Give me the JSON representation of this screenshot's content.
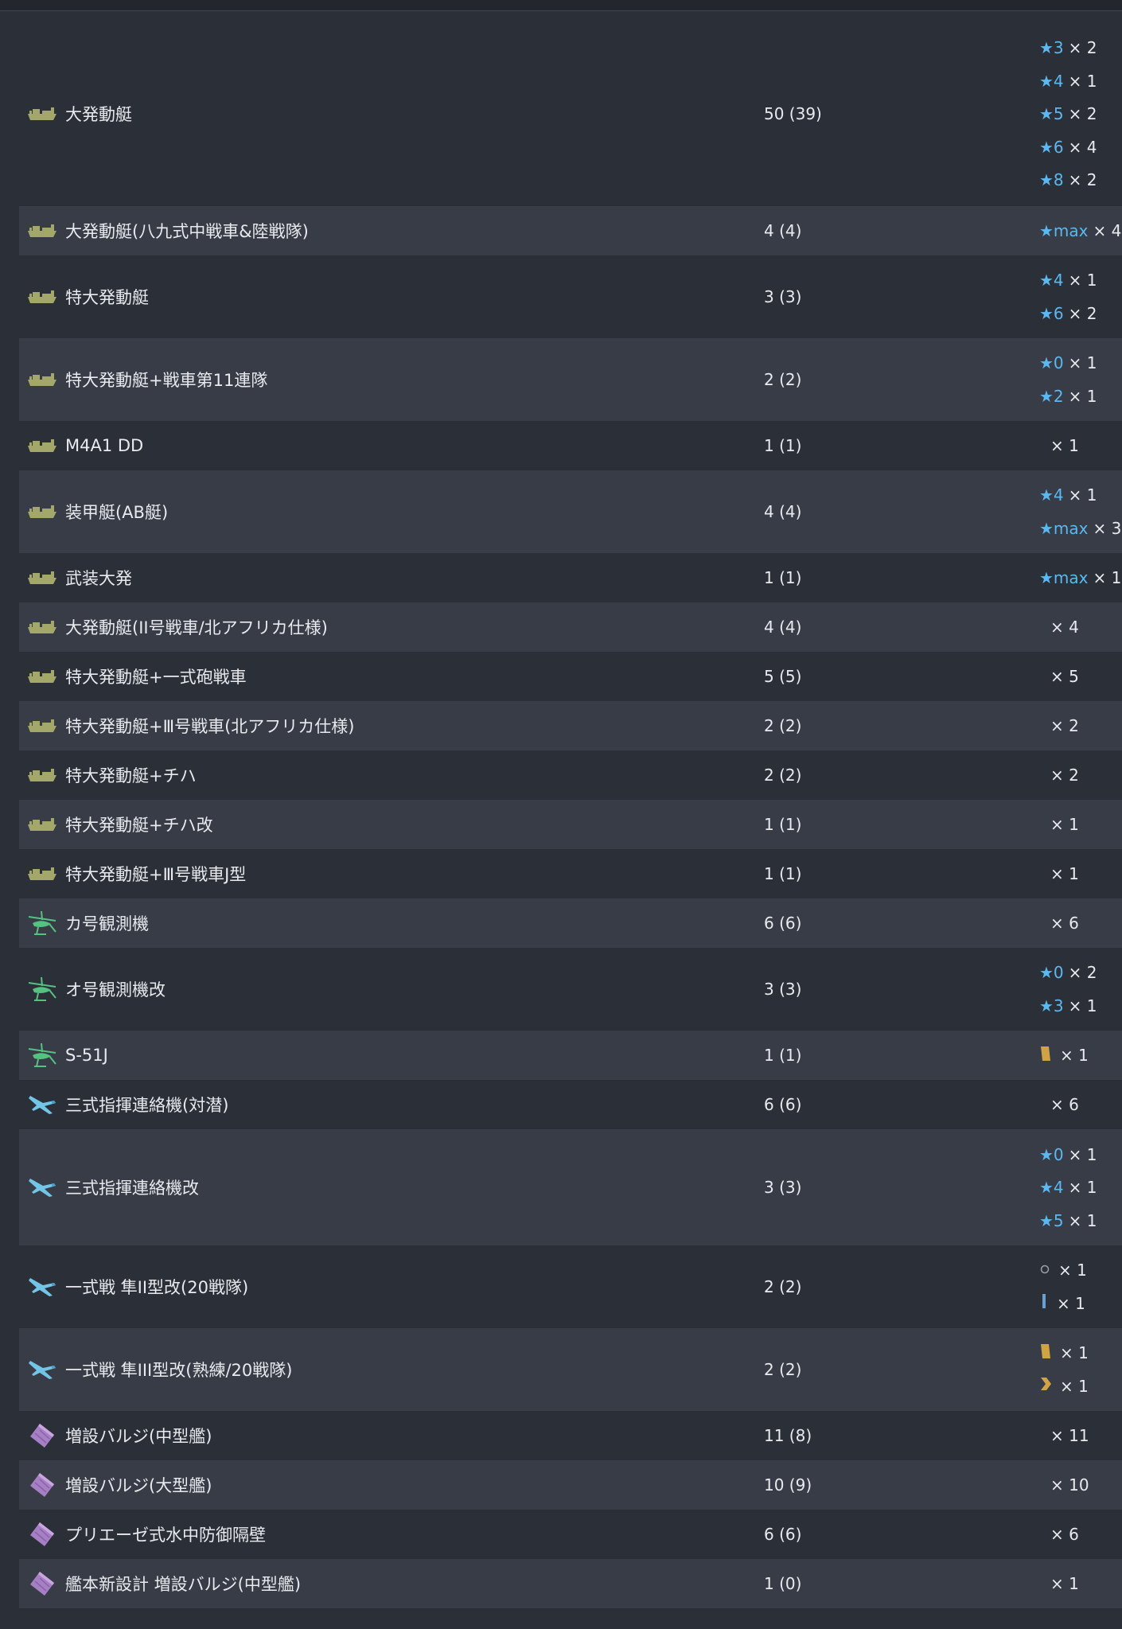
{
  "colors": {
    "star": "#5bb8f0",
    "landing_craft": "#a3a86a",
    "autogyro": "#56c282",
    "liaison": "#72c5e6",
    "bulge": "#a77fc5"
  },
  "rows": [
    {
      "name": "大発動艇",
      "count": "50 (39)",
      "icon": "landing-craft-icon",
      "levels": [
        {
          "star": "★3",
          "mul": "× 2"
        },
        {
          "star": "★4",
          "mul": "× 1"
        },
        {
          "star": "★5",
          "mul": "× 2"
        },
        {
          "star": "★6",
          "mul": "× 4"
        },
        {
          "star": "★8",
          "mul": "× 2"
        }
      ]
    },
    {
      "name": "大発動艇(八九式中戦車&陸戦隊)",
      "count": "4 (4)",
      "icon": "landing-craft-icon",
      "levels": [
        {
          "star": "★max",
          "mul": "× 4"
        }
      ]
    },
    {
      "name": "特大発動艇",
      "count": "3 (3)",
      "icon": "landing-craft-icon",
      "levels": [
        {
          "star": "★4",
          "mul": "× 1"
        },
        {
          "star": "★6",
          "mul": "× 2"
        }
      ]
    },
    {
      "name": "特大発動艇+戦車第11連隊",
      "count": "2 (2)",
      "icon": "landing-craft-icon",
      "levels": [
        {
          "star": "★0",
          "mul": "× 1"
        },
        {
          "star": "★2",
          "mul": "× 1"
        }
      ]
    },
    {
      "name": "M4A1 DD",
      "count": "1 (1)",
      "icon": "landing-craft-icon",
      "levels": [
        {
          "star": "",
          "mul": "× 1"
        }
      ]
    },
    {
      "name": "装甲艇(AB艇)",
      "count": "4 (4)",
      "icon": "landing-craft-icon",
      "levels": [
        {
          "star": "★4",
          "mul": "× 1"
        },
        {
          "star": "★max",
          "mul": "× 3"
        }
      ]
    },
    {
      "name": "武装大発",
      "count": "1 (1)",
      "icon": "landing-craft-icon",
      "levels": [
        {
          "star": "★max",
          "mul": "× 1"
        }
      ]
    },
    {
      "name": "大発動艇(II号戦車/北アフリカ仕様)",
      "count": "4 (4)",
      "icon": "landing-craft-icon",
      "levels": [
        {
          "star": "",
          "mul": "× 4"
        }
      ]
    },
    {
      "name": "特大発動艇+一式砲戦車",
      "count": "5 (5)",
      "icon": "landing-craft-icon",
      "levels": [
        {
          "star": "",
          "mul": "× 5"
        }
      ]
    },
    {
      "name": "特大発動艇+Ⅲ号戦車(北アフリカ仕様)",
      "count": "2 (2)",
      "icon": "landing-craft-icon",
      "levels": [
        {
          "star": "",
          "mul": "× 2"
        }
      ]
    },
    {
      "name": "特大発動艇+チハ",
      "count": "2 (2)",
      "icon": "landing-craft-icon",
      "levels": [
        {
          "star": "",
          "mul": "× 2"
        }
      ]
    },
    {
      "name": "特大発動艇+チハ改",
      "count": "1 (1)",
      "icon": "landing-craft-icon",
      "levels": [
        {
          "star": "",
          "mul": "× 1"
        }
      ]
    },
    {
      "name": "特大発動艇+Ⅲ号戦車J型",
      "count": "1 (1)",
      "icon": "landing-craft-icon",
      "levels": [
        {
          "star": "",
          "mul": "× 1"
        }
      ]
    },
    {
      "name": "カ号観測機",
      "count": "6 (6)",
      "icon": "autogyro-icon",
      "levels": [
        {
          "star": "",
          "mul": "× 6"
        }
      ]
    },
    {
      "name": "オ号観測機改",
      "count": "3 (3)",
      "icon": "autogyro-icon",
      "levels": [
        {
          "star": "★0",
          "mul": "× 2"
        },
        {
          "star": "★3",
          "mul": "× 1"
        }
      ]
    },
    {
      "name": "S-51J",
      "count": "1 (1)",
      "icon": "autogyro-icon",
      "levels": [
        {
          "prof": "gold-bar",
          "mul": "× 1"
        }
      ]
    },
    {
      "name": "三式指揮連絡機(対潜)",
      "count": "6 (6)",
      "icon": "liaison-plane-icon",
      "levels": [
        {
          "star": "",
          "mul": "× 6"
        }
      ]
    },
    {
      "name": "三式指揮連絡機改",
      "count": "3 (3)",
      "icon": "liaison-plane-icon",
      "levels": [
        {
          "star": "★0",
          "mul": "× 1"
        },
        {
          "star": "★4",
          "mul": "× 1"
        },
        {
          "star": "★5",
          "mul": "× 1"
        }
      ]
    },
    {
      "name": "一式戦 隼II型改(20戦隊)",
      "count": "2 (2)",
      "icon": "liaison-plane-icon",
      "levels": [
        {
          "prof": "circle",
          "mul": "× 1"
        },
        {
          "prof": "blue-bar",
          "mul": "× 1"
        }
      ]
    },
    {
      "name": "一式戦 隼III型改(熟練/20戦隊)",
      "count": "2 (2)",
      "icon": "liaison-plane-icon",
      "levels": [
        {
          "prof": "gold-bar",
          "mul": "× 1"
        },
        {
          "prof": "gold-chevron",
          "mul": "× 1"
        }
      ]
    },
    {
      "name": "増設バルジ(中型艦)",
      "count": "11 (8)",
      "icon": "bulge-icon",
      "levels": [
        {
          "star": "",
          "mul": "× 11"
        }
      ]
    },
    {
      "name": "増設バルジ(大型艦)",
      "count": "10 (9)",
      "icon": "bulge-icon",
      "levels": [
        {
          "star": "",
          "mul": "× 10"
        }
      ]
    },
    {
      "name": "プリエーゼ式水中防御隔壁",
      "count": "6 (6)",
      "icon": "bulge-icon",
      "levels": [
        {
          "star": "",
          "mul": "× 6"
        }
      ]
    },
    {
      "name": "艦本新設計 増設バルジ(中型艦)",
      "count": "1 (0)",
      "icon": "bulge-icon",
      "levels": [
        {
          "star": "",
          "mul": "× 1"
        }
      ]
    }
  ]
}
